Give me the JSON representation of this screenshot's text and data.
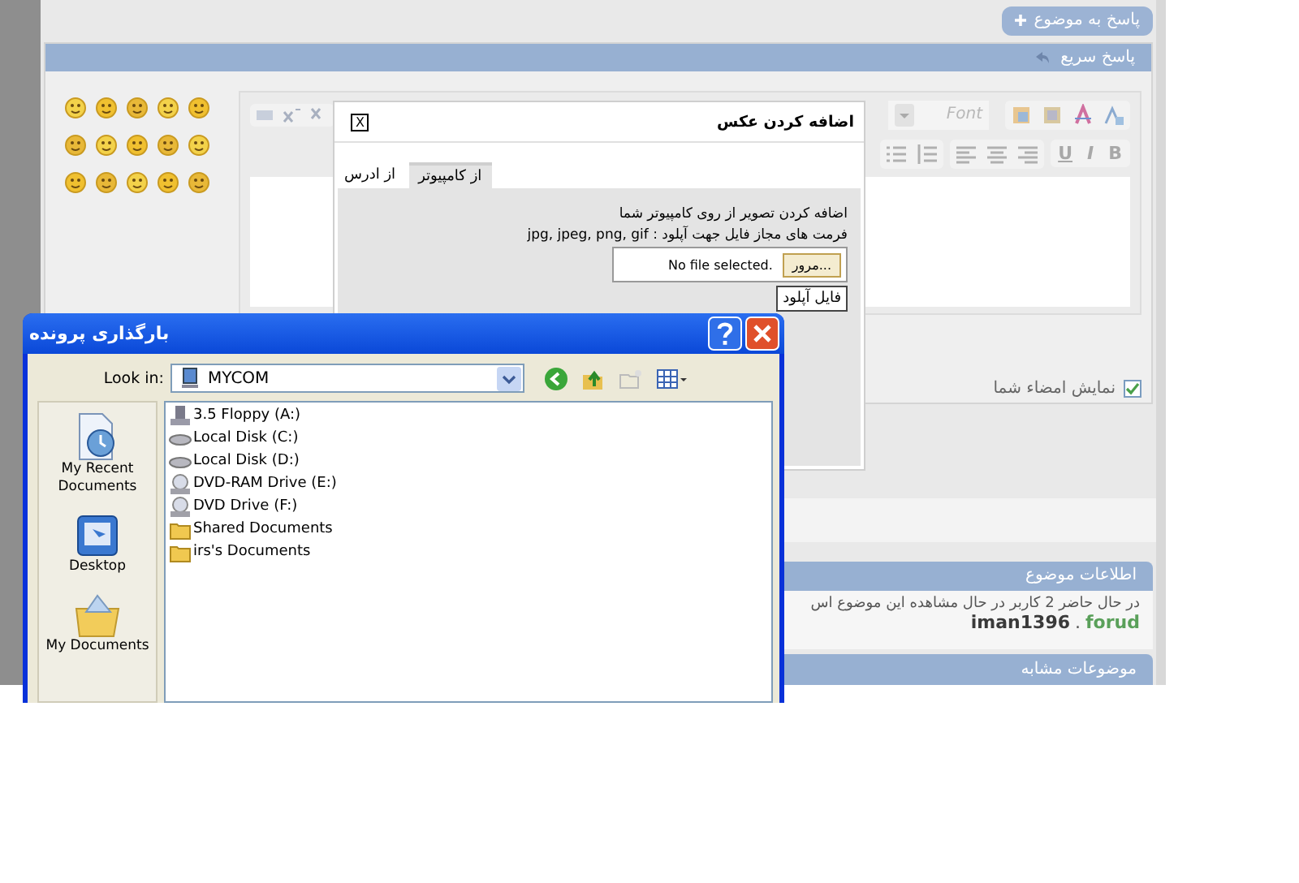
{
  "page": {
    "reply_button": "پاسخ به موضوع",
    "quick_reply": {
      "title": "پاسخ سریع",
      "font_placeholder": "Font",
      "format_buttons": [
        "B",
        "I",
        "U"
      ],
      "show_signature": {
        "label": "نمایش امضاء شما",
        "checked": true
      }
    },
    "info_panel": {
      "title": "اطلاعات موضوع",
      "text": "در حال حاضر 2 کاربر در حال مشاهده این موضوع اس",
      "separator": ".",
      "users": [
        {
          "name": "forud",
          "color": "#5aa05a"
        },
        {
          "name": "iman1396",
          "color": "#3a3a3a"
        }
      ]
    },
    "similar_panel": {
      "title": "موضوعات مشابه"
    }
  },
  "image_dialog": {
    "title": "اضافه کردن عکس",
    "close": "X",
    "tabs": [
      {
        "label": "از کامپیوتر",
        "selected": true
      },
      {
        "label": "از ادرس",
        "selected": false
      }
    ],
    "lines": [
      "اضافه کردن تصویر از روی کامپیوتر شما",
      "فرمت های مجاز فایل جهت آپلود : jpg, jpeg, png, gif"
    ],
    "file_status": "No file selected.",
    "browse_button": "مرور...",
    "upload_button": "فایل آپلود"
  },
  "file_dialog": {
    "title": "بارگذاری پرونده",
    "look_in_label": "Look in:",
    "look_in_value": "MYCOM",
    "places": [
      {
        "label": "My Recent Documents",
        "kind": "recent"
      },
      {
        "label": "Desktop",
        "kind": "desktop"
      },
      {
        "label": "My Documents",
        "kind": "documents"
      }
    ],
    "files": [
      {
        "name": "3.5 Floppy (A:)",
        "kind": "floppy"
      },
      {
        "name": "Local Disk (C:)",
        "kind": "disk"
      },
      {
        "name": "Local Disk (D:)",
        "kind": "disk"
      },
      {
        "name": "DVD-RAM Drive (E:)",
        "kind": "dvd"
      },
      {
        "name": "DVD Drive (F:)",
        "kind": "dvd"
      },
      {
        "name": "Shared Documents",
        "kind": "folder"
      },
      {
        "name": "irs's Documents",
        "kind": "folder"
      }
    ]
  }
}
